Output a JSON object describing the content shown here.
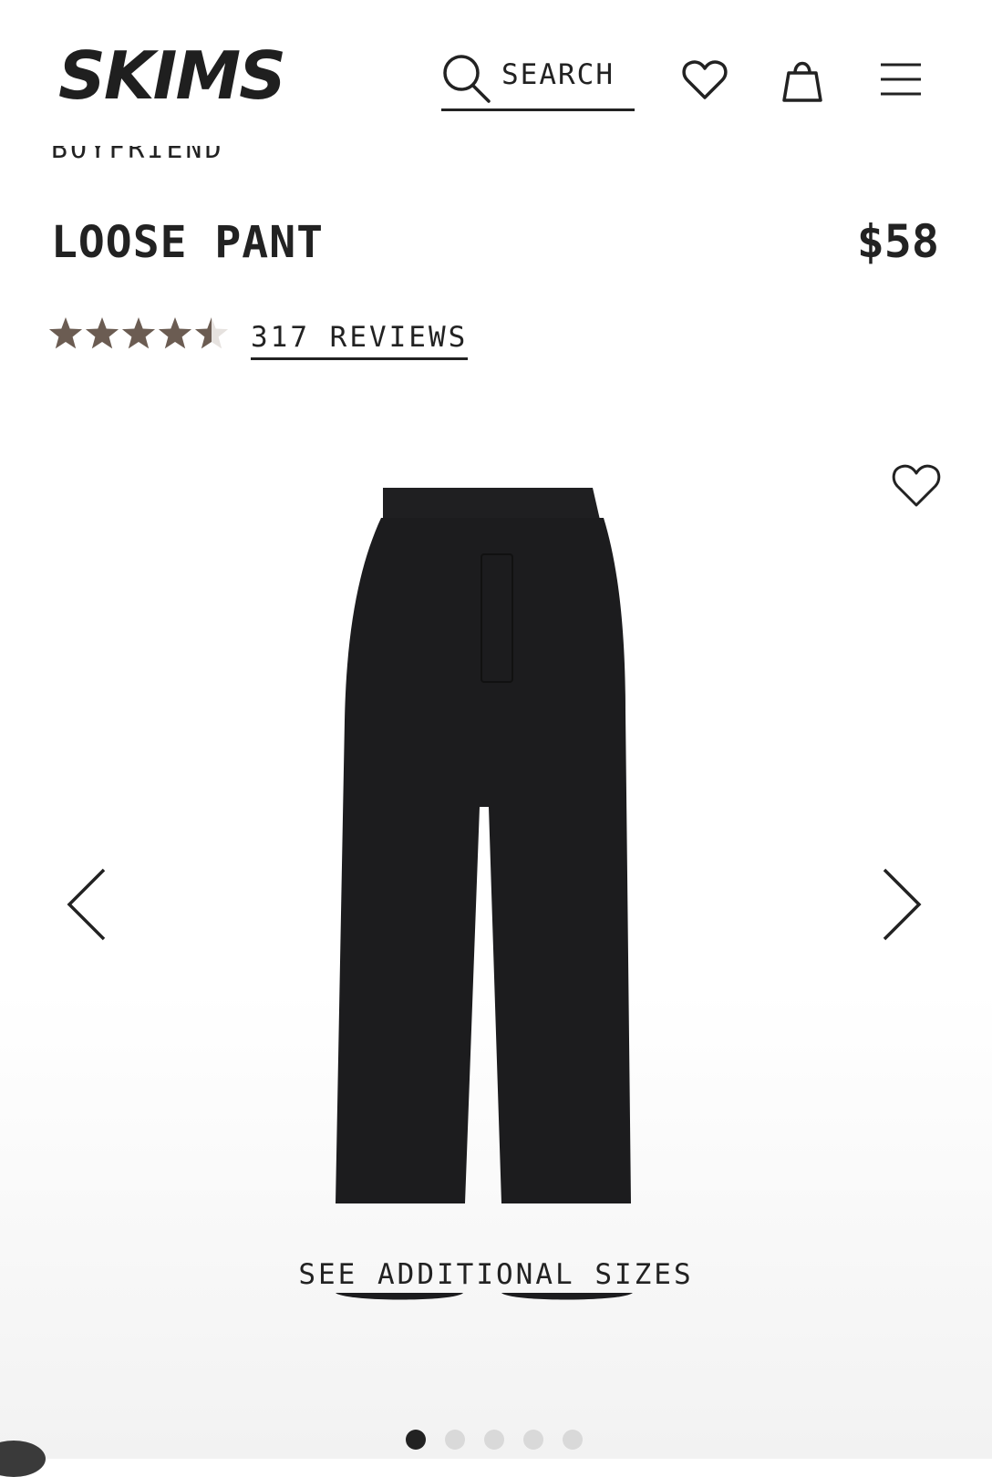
{
  "header": {
    "logo_text": "SKIMS",
    "search_label": "SEARCH",
    "icons": [
      "search-icon",
      "heart-icon",
      "bag-icon",
      "menu-icon"
    ]
  },
  "product": {
    "breadcrumb": "BOYFRIEND",
    "title": "LOOSE PANT",
    "price": "$58",
    "rating": 4.5,
    "rating_max": 5,
    "reviews_label": "317 REVIEWS"
  },
  "gallery": {
    "see_sizes_label": "SEE ADDITIONAL SIZES",
    "slide_count": 5,
    "active_slide": 1,
    "icons": [
      "heart-outline-icon",
      "chevron-left-icon",
      "chevron-right-icon"
    ]
  },
  "colors": {
    "text": "#222222",
    "star": "#6b5c52",
    "star_empty": "#e6e2df",
    "product": "#1c1c1e"
  }
}
